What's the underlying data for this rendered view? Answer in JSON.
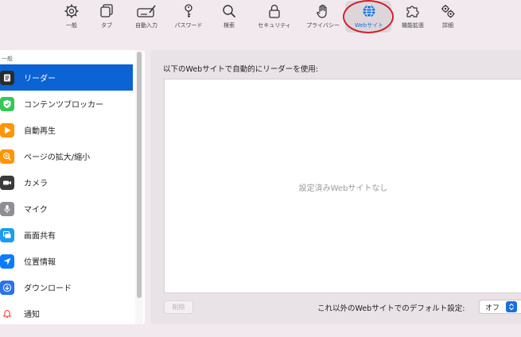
{
  "toolbar": {
    "items": [
      {
        "label": "一般",
        "icon": "gear-icon"
      },
      {
        "label": "タブ",
        "icon": "tabs-icon"
      },
      {
        "label": "自動入力",
        "icon": "autofill-icon"
      },
      {
        "label": "パスワード",
        "icon": "key-icon"
      },
      {
        "label": "検索",
        "icon": "search-icon"
      },
      {
        "label": "セキュリティ",
        "icon": "lock-icon"
      },
      {
        "label": "プライバシー",
        "icon": "hand-icon"
      },
      {
        "label": "Webサイト",
        "icon": "globe-icon"
      },
      {
        "label": "機能拡張",
        "icon": "puzzle-icon"
      },
      {
        "label": "詳細",
        "icon": "advanced-gears-icon"
      }
    ],
    "selected": "Webサイト"
  },
  "sidebar": {
    "header": "一般",
    "items": [
      {
        "label": "リーダー",
        "icon": "reader-icon",
        "color": "#2b2b2b"
      },
      {
        "label": "コンテンツブロッカー",
        "icon": "shield-check-icon",
        "color": "#34c759"
      },
      {
        "label": "自動再生",
        "icon": "play-icon",
        "color": "#ff9500"
      },
      {
        "label": "ページの拡大/縮小",
        "icon": "zoom-icon",
        "color": "#ff9500"
      },
      {
        "label": "カメラ",
        "icon": "camera-icon",
        "color": "#3a3a3a"
      },
      {
        "label": "マイク",
        "icon": "microphone-icon",
        "color": "#8e8e93"
      },
      {
        "label": "画面共有",
        "icon": "screen-share-icon",
        "color": "#1e9bf0"
      },
      {
        "label": "位置情報",
        "icon": "location-icon",
        "color": "#0a7cff"
      },
      {
        "label": "ダウンロード",
        "icon": "download-icon",
        "color": "#2a73ea"
      },
      {
        "label": "通知",
        "icon": "bell-icon",
        "color": "#ff3b30"
      }
    ],
    "selected_color": "#0b63d4"
  },
  "main": {
    "title": "以下のWebサイトで自動的にリーダーを使用:",
    "empty_text": "設定済みWebサイトなし",
    "remove_label": "削除",
    "default_label": "これ以外のWebサイトでのデフォルト設定:",
    "default_value": "オフ"
  },
  "accent_color": "#1a6fdd",
  "highlight_color": "#d21f2a"
}
